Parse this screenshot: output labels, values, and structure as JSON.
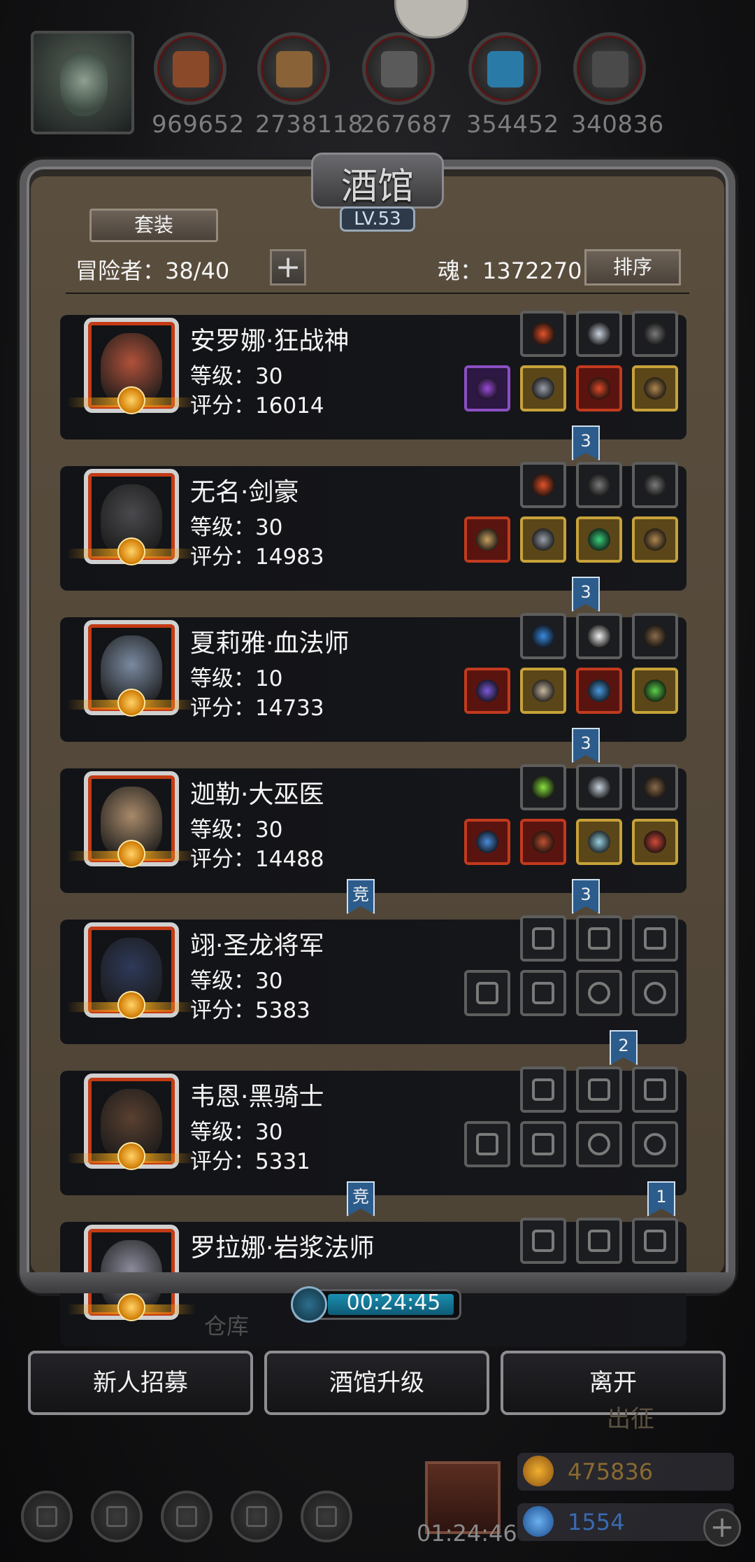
{
  "resources": [
    {
      "icon": "meat-icon",
      "value": "969652",
      "color": "#8a4a2a"
    },
    {
      "icon": "wood-icon",
      "value": "2738118",
      "color": "#8a6238"
    },
    {
      "icon": "iron-icon",
      "value": "267687",
      "color": "#5a5a5a"
    },
    {
      "icon": "crystal-icon",
      "value": "354452",
      "color": "#2a7aa8"
    },
    {
      "icon": "ore-icon",
      "value": "340836",
      "color": "#4a4a4a"
    }
  ],
  "tavern": {
    "title": "酒馆",
    "level": "LV.53",
    "suit_label": "套装",
    "adventurers": "冒险者：38/40",
    "plus_label": "+",
    "soul": "魂：1372270",
    "sort_label": "排序"
  },
  "heroes": [
    {
      "name": "安罗娜·狂战神",
      "level": "等级：30",
      "score": "评分：16014",
      "ribbon": "3",
      "top": [
        {
          "q": "e",
          "icon": "fire-orb-icon",
          "c": "#e2532a"
        },
        {
          "q": "e",
          "icon": "rune-icon",
          "c": "#c9d2de"
        },
        {
          "q": "e",
          "icon": "feather-icon",
          "c": "#7a7a7a"
        }
      ],
      "bottom": [
        {
          "q": "p",
          "icon": "staff-icon",
          "c": "#9a4ad8"
        },
        {
          "q": "g",
          "icon": "armor-icon",
          "c": "#9aa0aa"
        },
        {
          "q": "r",
          "icon": "eye-ring-icon",
          "c": "#e04a2a"
        },
        {
          "q": "g",
          "icon": "amulet-icon",
          "c": "#b08850"
        }
      ]
    },
    {
      "name": "无名·剑豪",
      "level": "等级：30",
      "score": "评分：14983",
      "ribbon": "3",
      "top": [
        {
          "q": "e",
          "icon": "fire-orb-icon",
          "c": "#e2532a"
        },
        {
          "q": "e",
          "icon": "feather-icon",
          "c": "#7a7a7a"
        },
        {
          "q": "e",
          "icon": "feather-icon",
          "c": "#7a7a7a"
        }
      ],
      "bottom": [
        {
          "q": "r",
          "icon": "sword-icon",
          "c": "#c8a060"
        },
        {
          "q": "g",
          "icon": "armor-icon",
          "c": "#9aa0aa"
        },
        {
          "q": "g",
          "icon": "emerald-icon",
          "c": "#3ad07a"
        },
        {
          "q": "g",
          "icon": "amulet-icon",
          "c": "#b08850"
        }
      ]
    },
    {
      "name": "夏莉雅·血法师",
      "level": "等级：10",
      "score": "评分：14733",
      "ribbon": "3",
      "top": [
        {
          "q": "e",
          "icon": "blue-orb-icon",
          "c": "#3a8ae0"
        },
        {
          "q": "e",
          "icon": "white-feather-icon",
          "c": "#f0f0f0"
        },
        {
          "q": "e",
          "icon": "scroll-icon",
          "c": "#8a6a4a"
        }
      ],
      "bottom": [
        {
          "q": "r",
          "icon": "wand-icon",
          "c": "#7a5ad8"
        },
        {
          "q": "g",
          "icon": "robe-icon",
          "c": "#c8b8a0"
        },
        {
          "q": "r",
          "icon": "crystal-ring-icon",
          "c": "#4a9ae0"
        },
        {
          "q": "g",
          "icon": "charm-icon",
          "c": "#5ad04a"
        }
      ]
    },
    {
      "name": "迦勒·大巫医",
      "level": "等级：30",
      "score": "评分：14488",
      "ribbon": "3",
      "extra_ribbon": "竞",
      "top": [
        {
          "q": "e",
          "icon": "flame-icon",
          "c": "#8ae040"
        },
        {
          "q": "e",
          "icon": "rune-icon",
          "c": "#c9d2de"
        },
        {
          "q": "e",
          "icon": "scroll-icon",
          "c": "#8a6a4a"
        }
      ],
      "bottom": [
        {
          "q": "r",
          "icon": "scepter-icon",
          "c": "#4a8ad8"
        },
        {
          "q": "r",
          "icon": "cloak-icon",
          "c": "#c05030"
        },
        {
          "q": "g",
          "icon": "ring-icon",
          "c": "#9ad0e0"
        },
        {
          "q": "g",
          "icon": "heart-charm-icon",
          "c": "#d04a3a"
        }
      ]
    },
    {
      "name": "翊·圣龙将军",
      "level": "等级：30",
      "score": "评分：5383",
      "ribbon": "2",
      "top": [
        {
          "q": "e",
          "icon": "flame-slot-icon",
          "c": "#5e5e5e"
        },
        {
          "q": "e",
          "icon": "hourglass-slot-icon",
          "c": "#5e5e5e"
        },
        {
          "q": "e",
          "icon": "hourglass-slot-icon",
          "c": "#5e5e5e"
        }
      ],
      "bottom": [
        {
          "q": "e",
          "icon": "sword-slot-icon",
          "c": "#5e5e5e"
        },
        {
          "q": "e",
          "icon": "armor-slot-icon",
          "c": "#5e5e5e"
        },
        {
          "q": "e",
          "icon": "ring-slot-icon",
          "c": "#5e5e5e"
        },
        {
          "q": "e",
          "icon": "ring-slot-icon",
          "c": "#5e5e5e"
        }
      ]
    },
    {
      "name": "韦恩·黑骑士",
      "level": "等级：30",
      "score": "评分：5331",
      "ribbon": "1",
      "extra_ribbon": "竞",
      "top": [
        {
          "q": "e",
          "icon": "flame-slot-icon",
          "c": "#5e5e5e"
        },
        {
          "q": "e",
          "icon": "hourglass-slot-icon",
          "c": "#5e5e5e"
        },
        {
          "q": "e",
          "icon": "hourglass-slot-icon",
          "c": "#5e5e5e"
        }
      ],
      "bottom": [
        {
          "q": "e",
          "icon": "sword-slot-icon",
          "c": "#5e5e5e"
        },
        {
          "q": "e",
          "icon": "armor-slot-icon",
          "c": "#5e5e5e"
        },
        {
          "q": "e",
          "icon": "ring-slot-icon",
          "c": "#5e5e5e"
        },
        {
          "q": "e",
          "icon": "ring-slot-icon",
          "c": "#5e5e5e"
        }
      ]
    },
    {
      "name": "罗拉娜·岩浆法师",
      "level": "",
      "score": "",
      "top": [
        {
          "q": "e",
          "icon": "flame-slot-icon",
          "c": "#5e5e5e"
        },
        {
          "q": "e",
          "icon": "hourglass-slot-icon",
          "c": "#5e5e5e"
        },
        {
          "q": "e",
          "icon": "hourglass-slot-icon",
          "c": "#5e5e5e"
        }
      ],
      "bottom": []
    }
  ],
  "timer": "00:24:45",
  "background_label": "仓库",
  "buttons": {
    "recruit": "新人招募",
    "upgrade": "酒馆升级",
    "leave": "离开"
  },
  "faded_label": "出征",
  "footer": {
    "gift_timer": "01:24:46",
    "gold": "475836",
    "gem": "1554",
    "plus": "+"
  }
}
